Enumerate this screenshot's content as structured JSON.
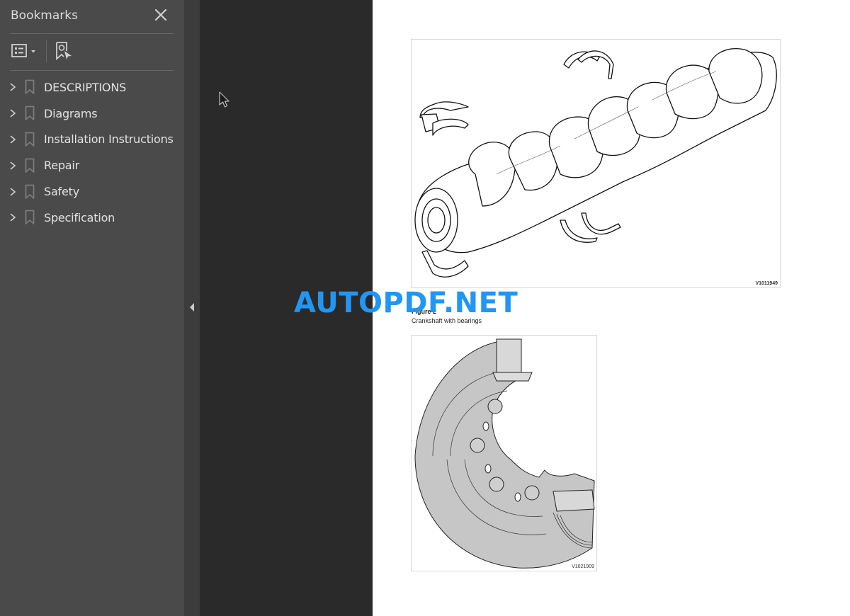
{
  "sidebar": {
    "title": "Bookmarks",
    "close_icon": "close-icon",
    "toolbar": {
      "options_icon": "list-options-icon",
      "options_dropdown_icon": "caret-down-icon",
      "find_bookmark_icon": "find-current-bookmark-icon"
    },
    "items": [
      {
        "label": "DESCRIPTIONS",
        "icon": "bookmark-icon"
      },
      {
        "label": "Diagrams",
        "icon": "bookmark-icon"
      },
      {
        "label": "Installation Instructions",
        "icon": "bookmark-icon"
      },
      {
        "label": "Repair",
        "icon": "bookmark-icon"
      },
      {
        "label": "Safety",
        "icon": "bookmark-icon"
      },
      {
        "label": "Specification",
        "icon": "bookmark-icon"
      }
    ]
  },
  "splitter": {
    "collapse_icon": "triangle-left-icon"
  },
  "document": {
    "figure1": {
      "code": "V1011949"
    },
    "figure_title": "Figure 2",
    "figure_caption": "Crankshaft with bearings",
    "figure2": {
      "code": "V1021909"
    }
  },
  "watermark": "AUTOPDF.NET",
  "colors": {
    "sidebar_bg": "#4a4a4a",
    "viewer_bg": "#2a2a2a",
    "watermark": "#2196f3"
  }
}
